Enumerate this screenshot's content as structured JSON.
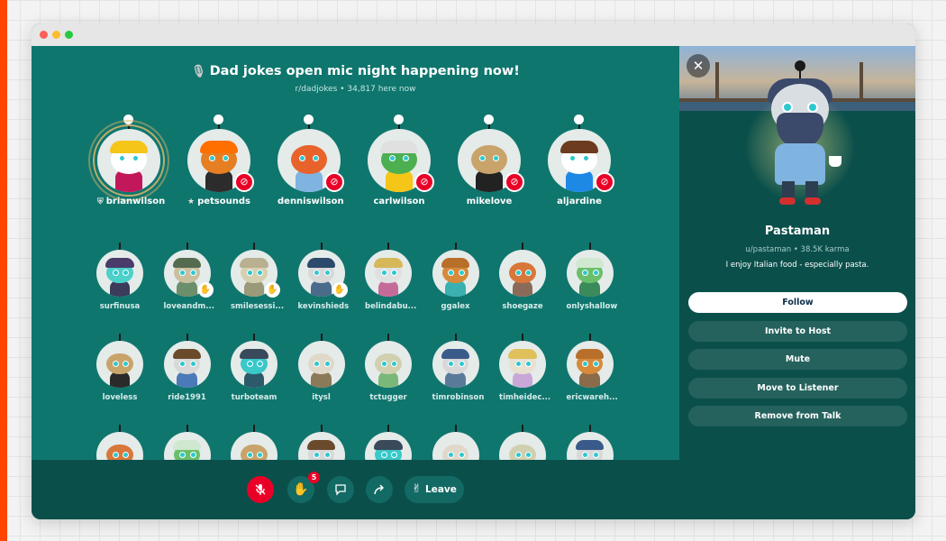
{
  "talk": {
    "title": "Dad jokes open mic night happening now!",
    "subtitle": "r/dadjokes • 34,817 here now"
  },
  "speakers": [
    {
      "name": "brianwilson",
      "prefix_icon": "shield-icon",
      "muted": false,
      "ringed": true,
      "hair": "#f5c518",
      "face": "#ffffff",
      "body": "#c2185b"
    },
    {
      "name": "petsounds",
      "prefix_icon": "star-icon",
      "muted": true,
      "ringed": false,
      "hair": "#ff6f00",
      "face": "#e67e22",
      "body": "#2c2c2c"
    },
    {
      "name": "denniswilson",
      "prefix_icon": "",
      "muted": true,
      "ringed": false,
      "hair": "",
      "face": "#e8632b",
      "body": "#7fb3e0"
    },
    {
      "name": "carlwilson",
      "prefix_icon": "",
      "muted": true,
      "ringed": false,
      "hair": "#e0e0e0",
      "face": "#4caf50",
      "body": "#f5c518"
    },
    {
      "name": "mikelove",
      "prefix_icon": "",
      "muted": true,
      "ringed": false,
      "hair": "",
      "face": "#c8a36a",
      "body": "#222222"
    },
    {
      "name": "aljardine",
      "prefix_icon": "",
      "muted": true,
      "ringed": false,
      "hair": "#6d3b1f",
      "face": "#ffffff",
      "body": "#1e88e5"
    }
  ],
  "listeners": [
    {
      "name": "surfinusa",
      "hand": false,
      "face": "#4dd0c8",
      "hair": "#4a3b6b",
      "body": "#3b3b5b"
    },
    {
      "name": "loveandm...",
      "hand": true,
      "face": "#c9c0a0",
      "hair": "#556b4f",
      "body": "#6b8e6b"
    },
    {
      "name": "smilesessi...",
      "hand": true,
      "face": "#d6d0b0",
      "hair": "#b8b090",
      "body": "#9a9a7a"
    },
    {
      "name": "kevinshieds",
      "hand": true,
      "face": "#d8d8d8",
      "hair": "#2c4a6b",
      "body": "#4a6b8a"
    },
    {
      "name": "belindabu...",
      "hand": false,
      "face": "#e0e0e0",
      "hair": "#d6b85a",
      "body": "#c46b9a"
    },
    {
      "name": "ggalex",
      "hand": false,
      "face": "#d68a3a",
      "hair": "#b86f2a",
      "body": "#3ab0b0"
    },
    {
      "name": "shoegaze",
      "hand": false,
      "face": "#d8773a",
      "hair": "",
      "body": "#8a6b5a"
    },
    {
      "name": "onlyshallow",
      "hand": false,
      "face": "#6bbf6b",
      "hair": "#cfe8cf",
      "body": "#3a8a5a"
    },
    {
      "name": "loveless",
      "hand": false,
      "face": "#c8a36a",
      "hair": "",
      "body": "#2a2a2a"
    },
    {
      "name": "ride1991",
      "hand": false,
      "face": "#d8d8d8",
      "hair": "#6b4a2c",
      "body": "#4a7ab8"
    },
    {
      "name": "turboteam",
      "hand": false,
      "face": "#3ac8c8",
      "hair": "#3a4a5a",
      "body": "#2c5a6b"
    },
    {
      "name": "itysl",
      "hand": false,
      "face": "#e0d8c8",
      "hair": "",
      "body": "#8a7a5a"
    },
    {
      "name": "tctugger",
      "hand": false,
      "face": "#d0d0b0",
      "hair": "",
      "body": "#7ab87a"
    },
    {
      "name": "timrobinson",
      "hand": false,
      "face": "#d8d8d8",
      "hair": "#3a5a8a",
      "body": "#5a7a9a"
    },
    {
      "name": "timheidec...",
      "hand": false,
      "face": "#e8e0d0",
      "hair": "#e0c05a",
      "body": "#c8a8d8"
    },
    {
      "name": "ericwareh...",
      "hand": false,
      "face": "#d68a3a",
      "hair": "#b86f2a",
      "body": "#8a6b4a"
    },
    {
      "name": "",
      "hand": false,
      "face": "#d8773a",
      "hair": "",
      "body": "#8a8a8a"
    },
    {
      "name": "",
      "hand": false,
      "face": "#6bbf6b",
      "hair": "#cfe8cf",
      "body": "#3a8a5a"
    },
    {
      "name": "",
      "hand": false,
      "face": "#c8a36a",
      "hair": "",
      "body": "#2a2a2a"
    },
    {
      "name": "",
      "hand": false,
      "face": "#d8d8d8",
      "hair": "#6b4a2c",
      "body": "#4a7ab8"
    },
    {
      "name": "",
      "hand": false,
      "face": "#3ac8c8",
      "hair": "#3a4a5a",
      "body": "#2c5a6b"
    },
    {
      "name": "",
      "hand": false,
      "face": "#e0d8c8",
      "hair": "",
      "body": "#8a7a5a"
    },
    {
      "name": "",
      "hand": false,
      "face": "#d0d0b0",
      "hair": "",
      "body": "#7ab87a"
    },
    {
      "name": "",
      "hand": false,
      "face": "#d8d8d8",
      "hair": "#3a5a8a",
      "body": "#5a7a9a"
    }
  ],
  "controls": {
    "raise_hand_count": "5",
    "leave_label": "Leave",
    "mic_icon": "microphone-off-icon",
    "hand_icon": "raise-hand-icon",
    "comment_icon": "comment-icon",
    "share_icon": "share-icon",
    "leave_icon": "peace-hand-icon"
  },
  "profile": {
    "display_name": "Pastaman",
    "meta": "u/pastaman • 38.5K karma",
    "bio": "I enjoy Italian food - especially pasta.",
    "close_icon": "close-icon",
    "actions": {
      "follow": "Follow",
      "invite": "Invite to Host",
      "mute": "Mute",
      "move": "Move to Listener",
      "remove": "Remove from Talk"
    }
  },
  "colors": {
    "accent": "#ff4500",
    "main_bg": "#0f766e",
    "panel_bg": "#0b4f4b",
    "mute_red": "#ea0027"
  }
}
